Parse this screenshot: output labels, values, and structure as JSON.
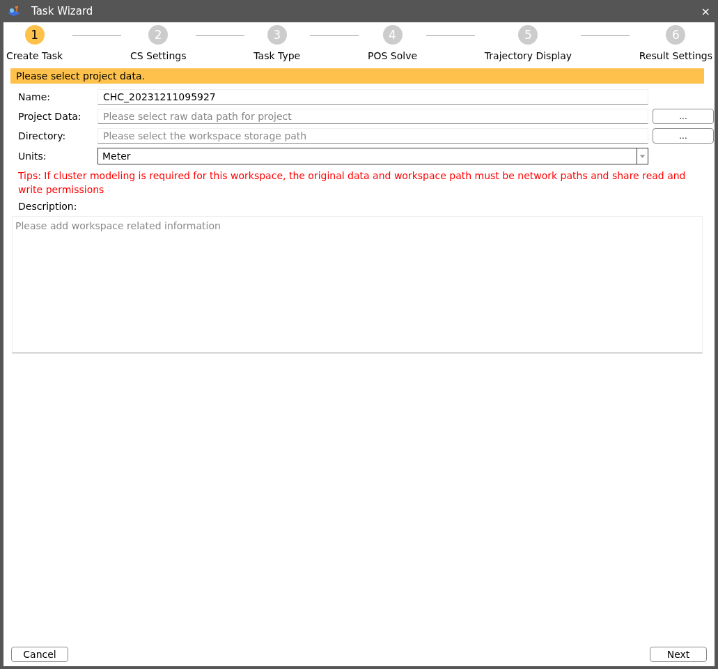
{
  "window": {
    "title": "Task Wizard",
    "close": "×"
  },
  "steps": [
    {
      "number": "1",
      "label": "Create Task",
      "selected": true
    },
    {
      "number": "2",
      "label": "CS Settings",
      "selected": false
    },
    {
      "number": "3",
      "label": "Task Type",
      "selected": false
    },
    {
      "number": "4",
      "label": "POS Solve",
      "selected": false
    },
    {
      "number": "5",
      "label": "Trajectory Display",
      "selected": false
    },
    {
      "number": "6",
      "label": "Result Settings",
      "selected": false
    }
  ],
  "banner": "Please select project data.",
  "fields": [
    {
      "kind": "text",
      "label": "Name:",
      "value": "CHC_20231211095927"
    },
    {
      "kind": "path",
      "label": "Project Data:",
      "placeholder": "Please select raw data path for project",
      "button": "..."
    },
    {
      "kind": "path",
      "label": "Directory:",
      "placeholder": "Please select the workspace storage path",
      "button": "..."
    },
    {
      "kind": "select",
      "label": "Units:",
      "value": "Meter"
    }
  ],
  "tips": "Tips: If cluster modeling is required for this workspace, the original data and workspace path must be network paths and share read and write permissions",
  "description": {
    "label": "Description:",
    "placeholder": "Please add workspace related information"
  },
  "buttons": {
    "cancel": "Cancel",
    "next": "Next"
  }
}
